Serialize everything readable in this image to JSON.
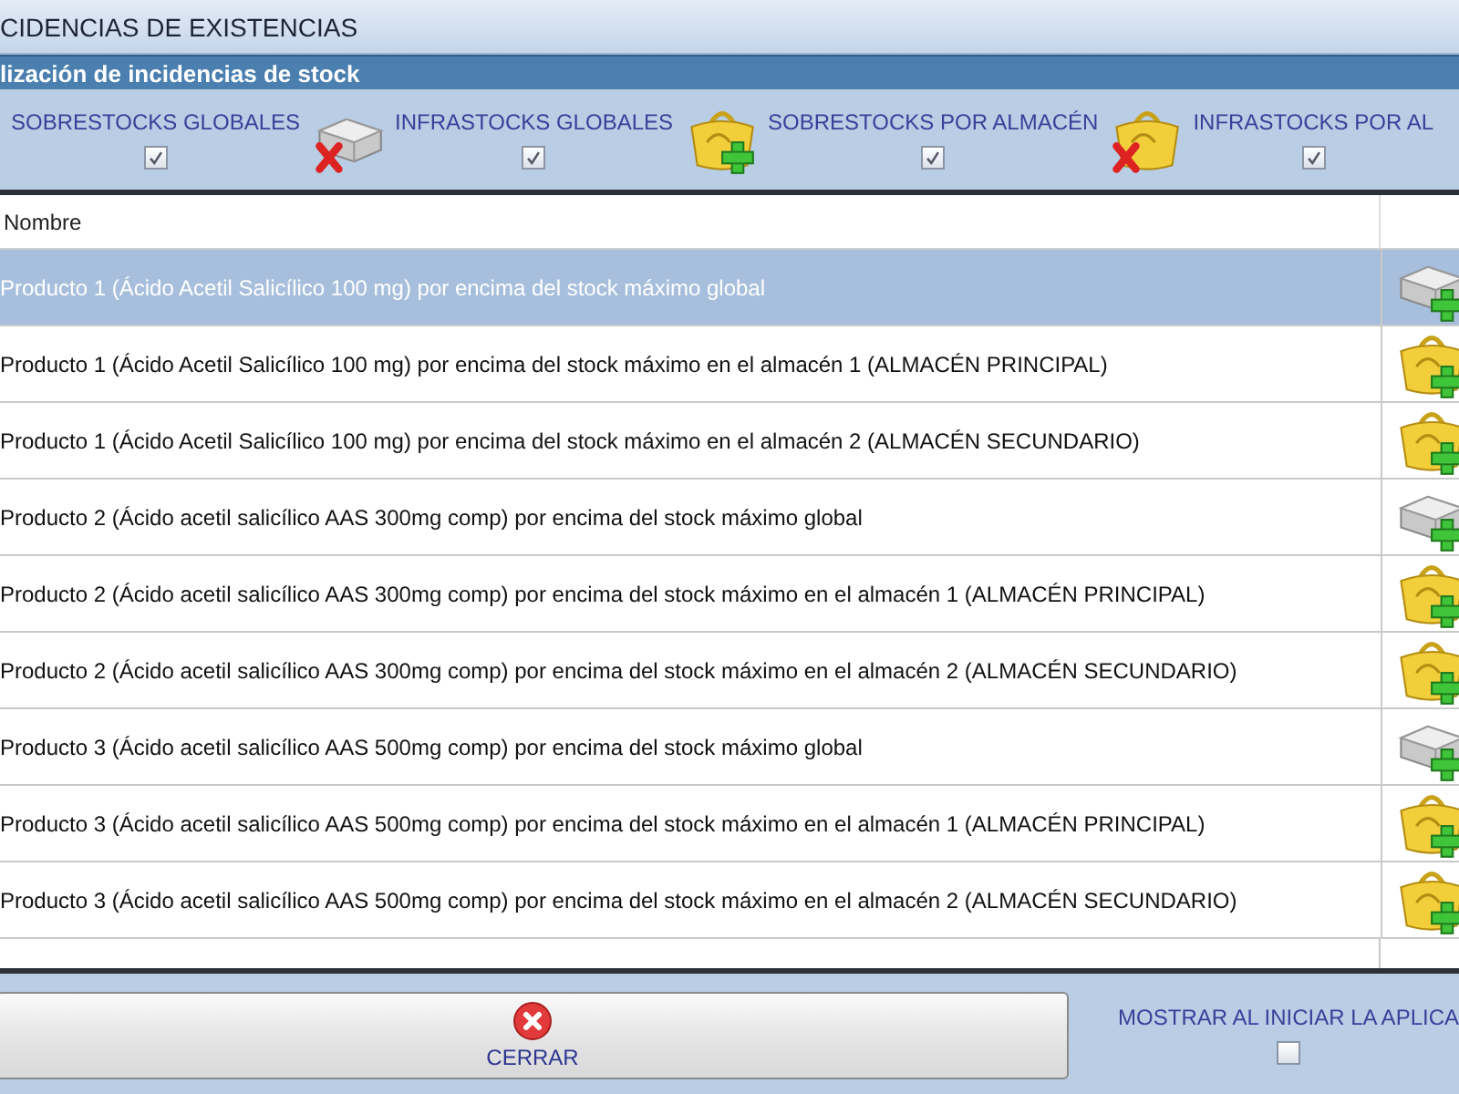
{
  "window": {
    "title": "CIDENCIAS DE EXISTENCIAS"
  },
  "section": {
    "title": "lización de incidencias de stock"
  },
  "filters": [
    {
      "label": "SOBRESTOCKS GLOBALES",
      "checked": true
    },
    {
      "label": "INFRASTOCKS GLOBALES",
      "checked": true,
      "icon": {
        "kind": "box-remove"
      }
    },
    {
      "label": "SOBRESTOCKS POR ALMACÉN",
      "checked": true,
      "icon": {
        "kind": "bag-add"
      }
    },
    {
      "label": "INFRASTOCKS POR AL",
      "checked": true,
      "icon": {
        "kind": "bag-remove"
      }
    }
  ],
  "table": {
    "columns": [
      "Nombre"
    ],
    "rows": [
      {
        "name": "Producto 1 (Ácido Acetil Salicílico 100 mg) por encima del stock máximo global",
        "selected": true,
        "icon": {
          "kind": "box-add"
        }
      },
      {
        "name": "Producto 1 (Ácido Acetil Salicílico 100 mg) por encima del stock máximo en el almacén 1 (ALMACÉN PRINCIPAL)",
        "selected": false,
        "icon": {
          "kind": "bag-add"
        }
      },
      {
        "name": "Producto 1 (Ácido Acetil Salicílico 100 mg) por encima del stock máximo en el almacén 2 (ALMACÉN SECUNDARIO)",
        "selected": false,
        "icon": {
          "kind": "bag-add"
        }
      },
      {
        "name": "Producto 2 (Ácido acetil salicílico AAS 300mg comp) por encima del stock máximo global",
        "selected": false,
        "icon": {
          "kind": "box-add"
        }
      },
      {
        "name": "Producto 2 (Ácido acetil salicílico AAS 300mg comp) por encima del stock máximo en el almacén 1 (ALMACÉN PRINCIPAL)",
        "selected": false,
        "icon": {
          "kind": "bag-add"
        }
      },
      {
        "name": "Producto 2 (Ácido acetil salicílico AAS 300mg comp) por encima del stock máximo en el almacén 2 (ALMACÉN SECUNDARIO)",
        "selected": false,
        "icon": {
          "kind": "bag-add"
        }
      },
      {
        "name": "Producto 3 (Ácido acetil salicílico AAS 500mg comp) por encima del stock máximo global",
        "selected": false,
        "icon": {
          "kind": "box-add"
        }
      },
      {
        "name": "Producto 3 (Ácido acetil salicílico AAS 500mg comp) por encima del stock máximo en el almacén 1 (ALMACÉN PRINCIPAL)",
        "selected": false,
        "icon": {
          "kind": "bag-add"
        }
      },
      {
        "name": "Producto 3 (Ácido acetil salicílico AAS 500mg comp) por encima del stock máximo en el almacén 2 (ALMACÉN SECUNDARIO)",
        "selected": false,
        "icon": {
          "kind": "bag-add"
        }
      }
    ]
  },
  "footer": {
    "close_button": "CERRAR",
    "startup_option": {
      "label": "MOSTRAR AL INICIAR LA APLICA",
      "checked": false
    }
  }
}
